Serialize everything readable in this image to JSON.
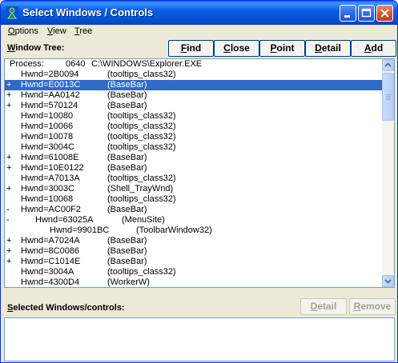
{
  "window": {
    "title": "Select Windows / Controls"
  },
  "menu": [
    "Options",
    "View",
    "Tree"
  ],
  "tree_label": "Window Tree:",
  "buttons": {
    "find": "Find",
    "close": "Close",
    "point": "Point",
    "detail": "Detail",
    "add": "Add"
  },
  "process": {
    "label": "Process:",
    "id": "0640",
    "path": "C:\\WINDOWS\\Explorer.EXE"
  },
  "rows": [
    {
      "mark": "",
      "hwnd": "Hwnd=2B0094",
      "cls": "(tooltips_class32)",
      "level": 1,
      "selected": false
    },
    {
      "mark": "+",
      "hwnd": "Hwnd=E0013C",
      "cls": "(BaseBar)",
      "level": 1,
      "selected": true
    },
    {
      "mark": "+",
      "hwnd": "Hwnd=AA0142",
      "cls": "(BaseBar)",
      "level": 1,
      "selected": false
    },
    {
      "mark": "+",
      "hwnd": "Hwnd=570124",
      "cls": "(BaseBar)",
      "level": 1,
      "selected": false
    },
    {
      "mark": "",
      "hwnd": "Hwnd=10080",
      "cls": "(tooltips_class32)",
      "level": 1,
      "selected": false
    },
    {
      "mark": "",
      "hwnd": "Hwnd=10066",
      "cls": "(tooltips_class32)",
      "level": 1,
      "selected": false
    },
    {
      "mark": "",
      "hwnd": "Hwnd=10078",
      "cls": "(tooltips_class32)",
      "level": 1,
      "selected": false
    },
    {
      "mark": "",
      "hwnd": "Hwnd=3004C",
      "cls": "(tooltips_class32)",
      "level": 1,
      "selected": false
    },
    {
      "mark": "+",
      "hwnd": "Hwnd=61008E",
      "cls": "(BaseBar)",
      "level": 1,
      "selected": false
    },
    {
      "mark": "+",
      "hwnd": "Hwnd=10E0122",
      "cls": "(BaseBar)",
      "level": 1,
      "selected": false
    },
    {
      "mark": "",
      "hwnd": "Hwnd=A7013A",
      "cls": "(tooltips_class32)",
      "level": 1,
      "selected": false
    },
    {
      "mark": "+",
      "hwnd": "Hwnd=3003C",
      "cls": "(Shell_TrayWnd)",
      "level": 1,
      "selected": false
    },
    {
      "mark": "",
      "hwnd": "Hwnd=10068",
      "cls": "(tooltips_class32)",
      "level": 1,
      "selected": false
    },
    {
      "mark": "-",
      "hwnd": "Hwnd=AC00F2",
      "cls": "(BaseBar)",
      "level": 1,
      "selected": false
    },
    {
      "mark": "-",
      "hwnd": "Hwnd=63025A",
      "cls": "(MenuSite)",
      "level": 2,
      "selected": false
    },
    {
      "mark": "",
      "hwnd": "Hwnd=9901BC",
      "cls": "(ToolbarWindow32)",
      "level": 3,
      "selected": false
    },
    {
      "mark": "+",
      "hwnd": "Hwnd=A7024A",
      "cls": "(BaseBar)",
      "level": 1,
      "selected": false
    },
    {
      "mark": "+",
      "hwnd": "Hwnd=8C0086",
      "cls": "(BaseBar)",
      "level": 1,
      "selected": false
    },
    {
      "mark": "+",
      "hwnd": "Hwnd=C1014E",
      "cls": "(BaseBar)",
      "level": 1,
      "selected": false
    },
    {
      "mark": "",
      "hwnd": "Hwnd=3004A",
      "cls": "(tooltips_class32)",
      "level": 1,
      "selected": false
    },
    {
      "mark": "",
      "hwnd": "Hwnd=4300D4",
      "cls": "(WorkerW)",
      "level": 1,
      "selected": false
    }
  ],
  "selected_label": "Selected Windows/controls:",
  "sel_buttons": {
    "detail": "Detail",
    "remove": "Remove"
  },
  "colors": {
    "titlebar": "#0553d6",
    "selection": "#316ac5",
    "face": "#ece9d8"
  }
}
